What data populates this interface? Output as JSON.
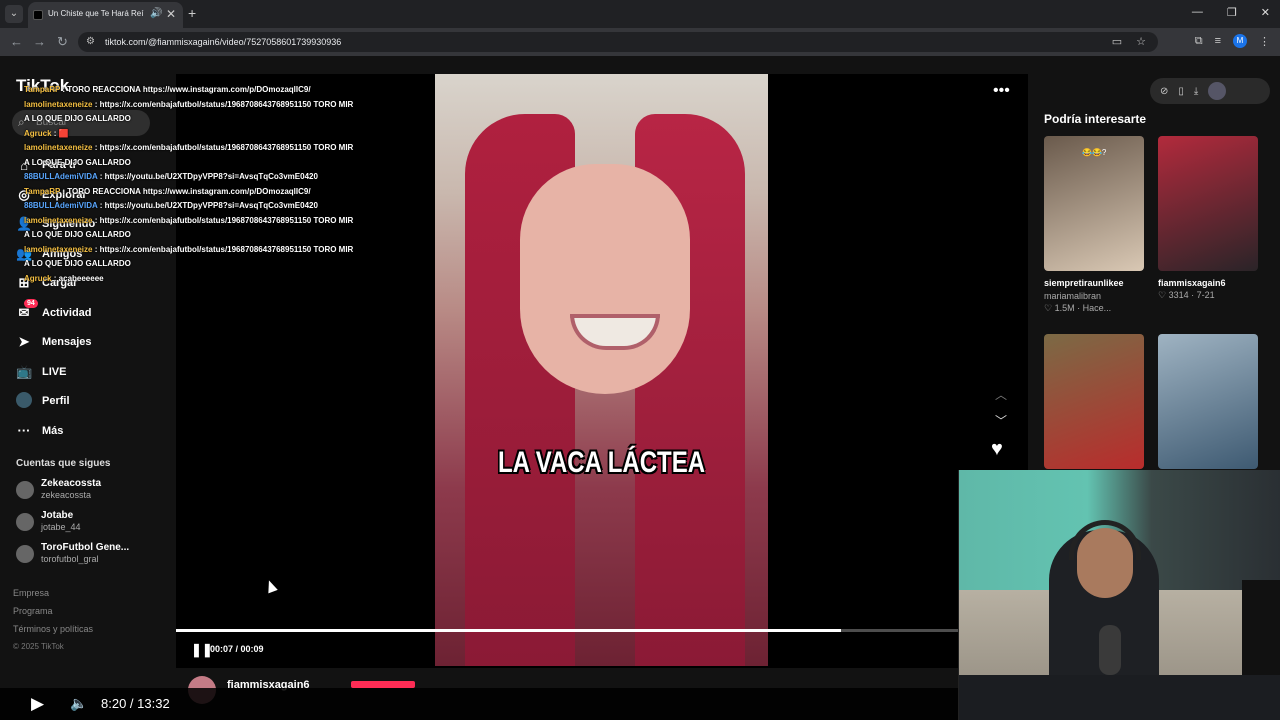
{
  "browser": {
    "tab_title": "Un Chiste que Te Hará Reí",
    "url": "tiktok.com/@fiammisxagain6/video/7527058601739930936",
    "profile_initial": "M"
  },
  "sidebar": {
    "logo": "TikTok",
    "search_label": "Buscar",
    "nav": [
      {
        "label": "Para ti",
        "icon": "home-icon"
      },
      {
        "label": "Explorar",
        "icon": "compass-icon"
      },
      {
        "label": "Siguiendo",
        "icon": "user-icon"
      },
      {
        "label": "Amigos",
        "icon": "friends-icon"
      },
      {
        "label": "Cargar",
        "icon": "upload-icon"
      },
      {
        "label": "Actividad",
        "icon": "inbox-icon",
        "badge": "94"
      },
      {
        "label": "Mensajes",
        "icon": "send-icon"
      },
      {
        "label": "LIVE",
        "icon": "live-icon"
      },
      {
        "label": "Perfil",
        "icon": "avatar"
      },
      {
        "label": "Más",
        "icon": "more-icon"
      }
    ],
    "following_title": "Cuentas que sigues",
    "following": [
      {
        "name": "Zekeacossta",
        "handle": "zekeacossta"
      },
      {
        "name": "Jotabe",
        "handle": "jotabe_44"
      },
      {
        "name": "ToroFutbol Gene...",
        "handle": "torofutbol_gral"
      }
    ],
    "footer": [
      "Empresa",
      "Programa",
      "Términos y políticas",
      "© 2025 TikTok"
    ]
  },
  "chat": [
    {
      "user": "TampaRP",
      "text": "TORO REACCIONA https://www.instagram.com/p/DOmozaqlIC9/",
      "color": "u1"
    },
    {
      "user": "lamolinetaxeneize",
      "text": "https://x.com/enbajafutbol/status/1968708643768951150 TORO MIRA LO QUE DIJO GALLARDO",
      "color": "u1"
    },
    {
      "user": "Agruck",
      "text": "🟥",
      "color": "u1"
    },
    {
      "user": "lamolinetaxeneize",
      "text": "https://x.com/enbajafutbol/status/1968708643768951150 TORO MIRA LO QUE DIJO GALLARDO",
      "color": "u1"
    },
    {
      "user": "88BULLAdemiVIDA",
      "text": "https://youtu.be/U2XTDpyVPP8?si=AvsqTqCo3vmE0420",
      "color": "u2"
    },
    {
      "user": "TampaRP",
      "text": "TORO REACCIONA https://www.instagram.com/p/DOmozaqlIC9/",
      "color": "u1"
    },
    {
      "user": "88BULLAdemiVIDA",
      "text": "https://youtu.be/U2XTDpyVPP8?si=AvsqTqCo3vmE0420",
      "color": "u2"
    },
    {
      "user": "lamolinetaxeneize",
      "text": "https://x.com/enbajafutbol/status/1968708643768951150 TORO MIRA LO QUE DIJO GALLARDO",
      "color": "u1"
    },
    {
      "user": "lamolinetaxeneize",
      "text": "https://x.com/enbajafutbol/status/1968708643768951150 TORO MIRA LO QUE DIJO GALLARDO",
      "color": "u1"
    },
    {
      "user": "Agruck",
      "text": "acabeeeeee",
      "color": "u1"
    }
  ],
  "video": {
    "caption": "LA VACA LÁCTEA",
    "time": "00:07 / 00:09",
    "progress": 0.78,
    "author": "fiammisxagain6"
  },
  "right": {
    "title": "Podría interesarte",
    "items": [
      {
        "title": "siempretiraunlikee",
        "sub": "mariamalibran",
        "stats": "1.5M · Hace...",
        "emoji": "😂😂?",
        "colors": [
          "#6a5a4c",
          "#d9c8b4"
        ]
      },
      {
        "title": "fiammisxagain6",
        "sub": "",
        "stats": "3314 · 7-21",
        "emoji": "",
        "colors": [
          "#b22a3c",
          "#2a2428"
        ]
      },
      {
        "title": "",
        "sub": "",
        "stats": "",
        "emoji": "",
        "colors": [
          "#7b6a45",
          "#b92c2c"
        ]
      },
      {
        "title": "",
        "sub": "",
        "stats": "",
        "emoji": "",
        "colors": [
          "#9fb3c2",
          "#3e5a72"
        ]
      }
    ]
  },
  "player": {
    "time": "8:20 / 13:32"
  }
}
